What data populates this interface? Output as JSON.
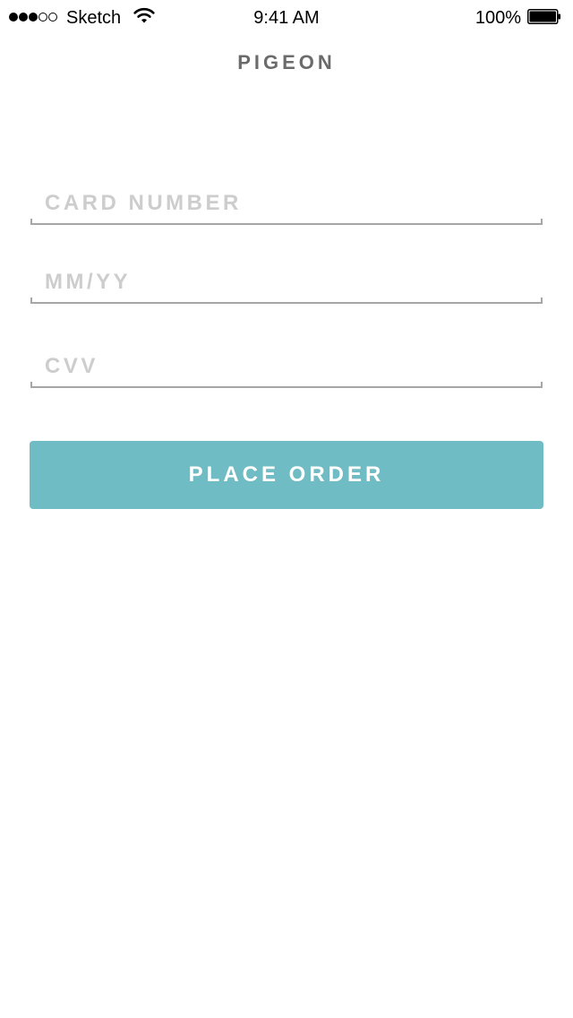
{
  "status_bar": {
    "signal_bars_filled": 3,
    "signal_bars_total": 5,
    "carrier": "Sketch",
    "time": "9:41 AM",
    "battery_percent": "100%",
    "battery_level": 1.0
  },
  "nav": {
    "title": "PIGEON"
  },
  "form": {
    "card_number": {
      "value": "",
      "placeholder": "CARD NUMBER"
    },
    "expiry": {
      "value": "",
      "placeholder": "MM/YY"
    },
    "cvv": {
      "value": "",
      "placeholder": "CVV"
    }
  },
  "actions": {
    "place_order_label": "PLACE ORDER"
  },
  "colors": {
    "accent": "#70bcc5",
    "title": "#6b6b6b",
    "placeholder": "#cdcdcd",
    "underline": "#a6a6a6"
  },
  "icons": {
    "signal": "signal-dots-icon",
    "wifi": "wifi-icon",
    "battery": "battery-icon"
  }
}
